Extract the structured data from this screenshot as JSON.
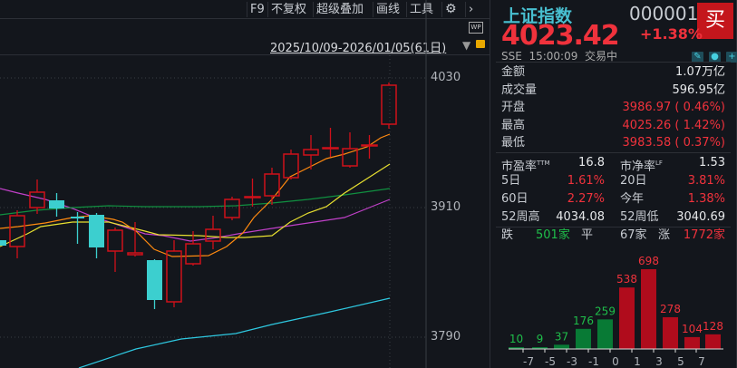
{
  "toolbar": {
    "items": [
      "F9",
      "不复权",
      "超级叠加",
      "画线",
      "工具"
    ],
    "settings_icon": "gear-icon",
    "more_icon": "chevron-right-icon"
  },
  "chart": {
    "date_range": "2025/10/09-2026/01/05(61日)",
    "y_labels": [
      "4030",
      "3910",
      "3790"
    ],
    "wp_label": "WP"
  },
  "quote": {
    "name": "上证指数",
    "code": "000001",
    "price": "4023.42",
    "change_pct": "+1.38%",
    "buy_label": "买",
    "exchange": "SSE",
    "time": "15:00:09",
    "status": "交易中"
  },
  "stats": [
    {
      "label": "金额",
      "value": "1.07万亿"
    },
    {
      "label": "成交量",
      "value": "596.95亿"
    },
    {
      "label": "开盘",
      "value": "3986.97 (  0.46%)"
    },
    {
      "label": "最高",
      "value": "4025.26 (  1.42%)"
    },
    {
      "label": "最低",
      "value": "3983.58 (  0.37%)"
    }
  ],
  "metrics": {
    "pe_label": "市盈率",
    "pe_sup": "TTM",
    "pe": "16.8",
    "pb_label": "市净率",
    "pb_sup": "LF",
    "pb": "1.53",
    "d5_label": "5日",
    "d5": "1.61%",
    "d20_label": "20日",
    "d20": "3.81%",
    "d60_label": "60日",
    "d60": "2.27%",
    "ytd_label": "今年",
    "ytd": "1.38%",
    "hi52_label": "52周高",
    "hi52": "4034.08",
    "lo52_label": "52周低",
    "lo52": "3040.69"
  },
  "breadth": {
    "down_label": "跌",
    "down": "501家",
    "flat_label": "平",
    "flat": "67家",
    "up_label": "涨",
    "up": "1772家"
  },
  "distribution": {
    "values": [
      10,
      9,
      37,
      176,
      259,
      538,
      698,
      278,
      104,
      128
    ],
    "signs": [
      "down",
      "down",
      "down",
      "down",
      "down",
      "up",
      "up",
      "up",
      "up",
      "up"
    ],
    "labels": [
      "10",
      "9",
      "37",
      "176",
      "259",
      "538",
      "698",
      "278",
      "104",
      "128"
    ],
    "ticks": [
      "-7",
      "-5",
      "-3",
      "-1",
      "0",
      "1",
      "3",
      "5",
      "7"
    ]
  },
  "colors": {
    "up": "#d0101a",
    "down": "#3ccfcf",
    "bar_up": "#b00c1c",
    "bar_down": "#087a35"
  }
}
